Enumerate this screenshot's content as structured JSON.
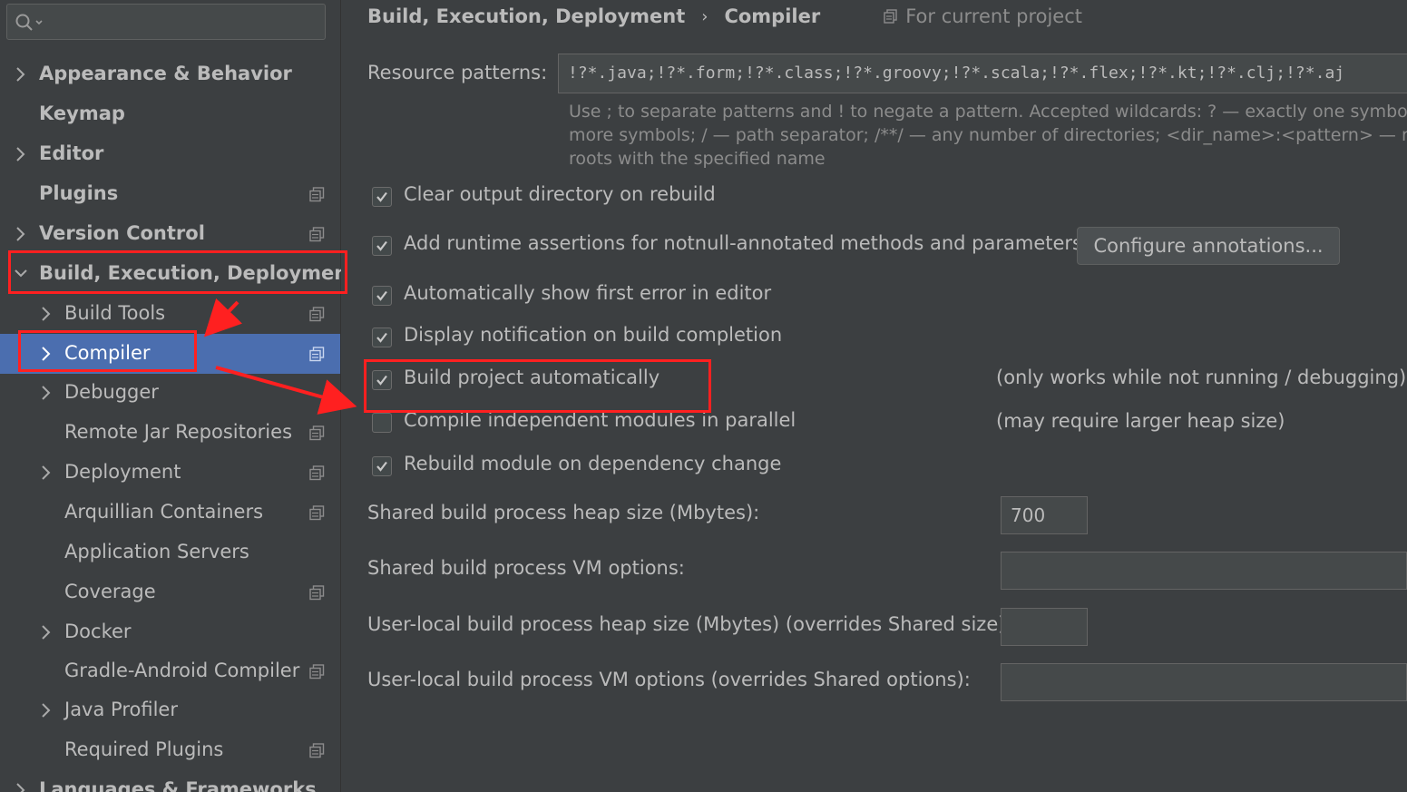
{
  "search": {
    "placeholder": ""
  },
  "sidebar": {
    "items": [
      {
        "label": "Appearance & Behavior",
        "expandable": true,
        "project_icon": false
      },
      {
        "label": "Keymap",
        "expandable": false,
        "project_icon": false
      },
      {
        "label": "Editor",
        "expandable": true,
        "project_icon": false
      },
      {
        "label": "Plugins",
        "expandable": false,
        "project_icon": true
      },
      {
        "label": "Version Control",
        "expandable": true,
        "project_icon": true
      },
      {
        "label": "Build, Execution, Deployment",
        "expandable": true,
        "expanded": true,
        "project_icon": false
      },
      {
        "label": "Build Tools",
        "expandable": true,
        "project_icon": true
      },
      {
        "label": "Compiler",
        "expandable": true,
        "project_icon": true,
        "selected": true
      },
      {
        "label": "Debugger",
        "expandable": true,
        "project_icon": false
      },
      {
        "label": "Remote Jar Repositories",
        "expandable": false,
        "project_icon": true
      },
      {
        "label": "Deployment",
        "expandable": true,
        "project_icon": true
      },
      {
        "label": "Arquillian Containers",
        "expandable": false,
        "project_icon": true
      },
      {
        "label": "Application Servers",
        "expandable": false,
        "project_icon": false
      },
      {
        "label": "Coverage",
        "expandable": false,
        "project_icon": true
      },
      {
        "label": "Docker",
        "expandable": true,
        "project_icon": false
      },
      {
        "label": "Gradle-Android Compiler",
        "expandable": false,
        "project_icon": true
      },
      {
        "label": "Java Profiler",
        "expandable": true,
        "project_icon": false
      },
      {
        "label": "Required Plugins",
        "expandable": false,
        "project_icon": true
      },
      {
        "label": "Languages & Frameworks",
        "expandable": true,
        "project_icon": false
      }
    ]
  },
  "header": {
    "crumb1": "Build, Execution, Deployment",
    "separator": "›",
    "crumb2": "Compiler",
    "scope": "For current project"
  },
  "resource": {
    "label": "Resource patterns:",
    "value": "!?*.java;!?*.form;!?*.class;!?*.groovy;!?*.scala;!?*.flex;!?*.kt;!?*.clj;!?*.aj",
    "hint_line1": "Use ; to separate patterns and ! to negate a pattern. Accepted wildcards: ? — exactly one symbol; * —",
    "hint_line2": "more symbols; / — path separator; /**/ — any number of directories; <dir_name>:<pattern> — rest",
    "hint_line3": "roots with the specified name"
  },
  "options": {
    "clear_output": {
      "label": "Clear output directory on rebuild",
      "checked": true
    },
    "runtime_assertions": {
      "label": "Add runtime assertions for notnull-annotated methods and parameters",
      "checked": true
    },
    "show_first_error": {
      "label": "Automatically show first error in editor",
      "checked": true
    },
    "notify_build": {
      "label": "Display notification on build completion",
      "checked": true
    },
    "build_auto": {
      "label": "Build project automatically",
      "checked": true,
      "note": "(only works while not running / debugging)"
    },
    "parallel": {
      "label": "Compile independent modules in parallel",
      "checked": false,
      "note": "(may require larger heap size)"
    },
    "rebuild_dep": {
      "label": "Rebuild module on dependency change",
      "checked": true
    }
  },
  "configure_button": "Configure annotations...",
  "fields": {
    "shared_heap": {
      "label": "Shared build process heap size (Mbytes):",
      "value": "700"
    },
    "shared_vm": {
      "label": "Shared build process VM options:",
      "value": ""
    },
    "local_heap": {
      "label": "User-local build process heap size (Mbytes) (overrides Shared size):",
      "value": ""
    },
    "local_vm": {
      "label": "User-local build process VM options (overrides Shared options):",
      "value": ""
    }
  },
  "colors": {
    "background": "#3c3f41",
    "selection": "#4b6eaf",
    "annotation": "#ff2020"
  }
}
